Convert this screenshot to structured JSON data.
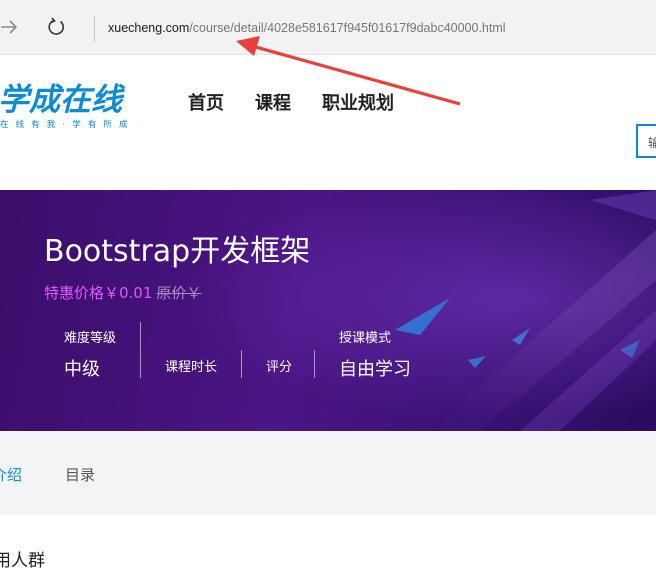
{
  "browser": {
    "url_domain": "xuecheng.com",
    "url_path": "/course/detail/4028e581617f945f01617f9dabc40000.html",
    "icons": {
      "back": "arrow-right-icon",
      "reload": "reload-icon"
    },
    "annotation_color": "#e8413b"
  },
  "header": {
    "logo_text": "学成在线",
    "logo_slogan": "在 线 有 我 · 学 有 所 成",
    "nav": [
      "首页",
      "课程",
      "职业规划"
    ],
    "search_partial": "输",
    "brand_color": "#0c8bd6"
  },
  "banner": {
    "title": "Bootstrap开发框架",
    "price_special": "特惠价格￥0.01",
    "price_original": "原价￥",
    "level_label": "难度等级",
    "level_value": "中级",
    "duration_label": "课程时长",
    "rating_label": "评分",
    "mode_label": "授课模式",
    "mode_value": "自由学习"
  },
  "tabs": {
    "intro": "介绍",
    "catalog": "目录"
  },
  "content": {
    "heading_partial": "用人群"
  }
}
